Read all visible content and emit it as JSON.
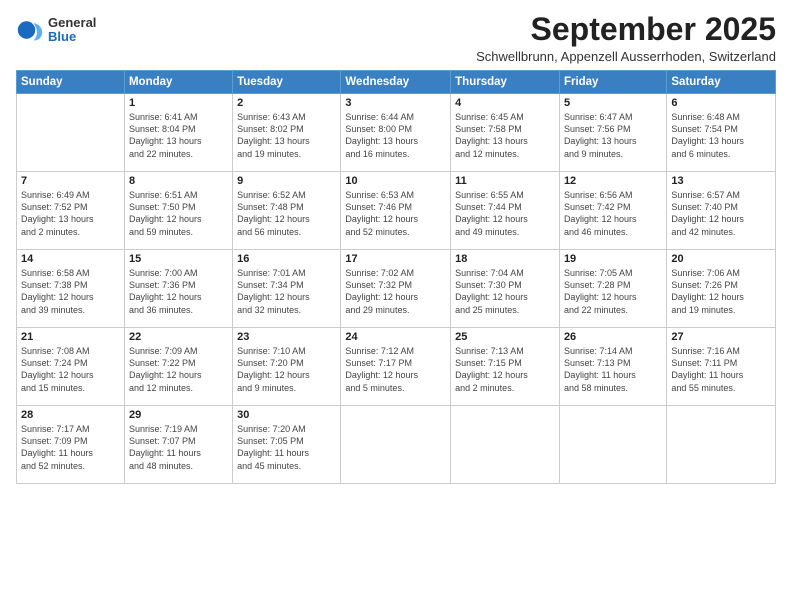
{
  "logo": {
    "general": "General",
    "blue": "Blue"
  },
  "title": "September 2025",
  "subtitle": "Schwellbrunn, Appenzell Ausserrhoden, Switzerland",
  "days_of_week": [
    "Sunday",
    "Monday",
    "Tuesday",
    "Wednesday",
    "Thursday",
    "Friday",
    "Saturday"
  ],
  "weeks": [
    [
      {
        "num": "",
        "info": ""
      },
      {
        "num": "1",
        "info": "Sunrise: 6:41 AM\nSunset: 8:04 PM\nDaylight: 13 hours\nand 22 minutes."
      },
      {
        "num": "2",
        "info": "Sunrise: 6:43 AM\nSunset: 8:02 PM\nDaylight: 13 hours\nand 19 minutes."
      },
      {
        "num": "3",
        "info": "Sunrise: 6:44 AM\nSunset: 8:00 PM\nDaylight: 13 hours\nand 16 minutes."
      },
      {
        "num": "4",
        "info": "Sunrise: 6:45 AM\nSunset: 7:58 PM\nDaylight: 13 hours\nand 12 minutes."
      },
      {
        "num": "5",
        "info": "Sunrise: 6:47 AM\nSunset: 7:56 PM\nDaylight: 13 hours\nand 9 minutes."
      },
      {
        "num": "6",
        "info": "Sunrise: 6:48 AM\nSunset: 7:54 PM\nDaylight: 13 hours\nand 6 minutes."
      }
    ],
    [
      {
        "num": "7",
        "info": "Sunrise: 6:49 AM\nSunset: 7:52 PM\nDaylight: 13 hours\nand 2 minutes."
      },
      {
        "num": "8",
        "info": "Sunrise: 6:51 AM\nSunset: 7:50 PM\nDaylight: 12 hours\nand 59 minutes."
      },
      {
        "num": "9",
        "info": "Sunrise: 6:52 AM\nSunset: 7:48 PM\nDaylight: 12 hours\nand 56 minutes."
      },
      {
        "num": "10",
        "info": "Sunrise: 6:53 AM\nSunset: 7:46 PM\nDaylight: 12 hours\nand 52 minutes."
      },
      {
        "num": "11",
        "info": "Sunrise: 6:55 AM\nSunset: 7:44 PM\nDaylight: 12 hours\nand 49 minutes."
      },
      {
        "num": "12",
        "info": "Sunrise: 6:56 AM\nSunset: 7:42 PM\nDaylight: 12 hours\nand 46 minutes."
      },
      {
        "num": "13",
        "info": "Sunrise: 6:57 AM\nSunset: 7:40 PM\nDaylight: 12 hours\nand 42 minutes."
      }
    ],
    [
      {
        "num": "14",
        "info": "Sunrise: 6:58 AM\nSunset: 7:38 PM\nDaylight: 12 hours\nand 39 minutes."
      },
      {
        "num": "15",
        "info": "Sunrise: 7:00 AM\nSunset: 7:36 PM\nDaylight: 12 hours\nand 36 minutes."
      },
      {
        "num": "16",
        "info": "Sunrise: 7:01 AM\nSunset: 7:34 PM\nDaylight: 12 hours\nand 32 minutes."
      },
      {
        "num": "17",
        "info": "Sunrise: 7:02 AM\nSunset: 7:32 PM\nDaylight: 12 hours\nand 29 minutes."
      },
      {
        "num": "18",
        "info": "Sunrise: 7:04 AM\nSunset: 7:30 PM\nDaylight: 12 hours\nand 25 minutes."
      },
      {
        "num": "19",
        "info": "Sunrise: 7:05 AM\nSunset: 7:28 PM\nDaylight: 12 hours\nand 22 minutes."
      },
      {
        "num": "20",
        "info": "Sunrise: 7:06 AM\nSunset: 7:26 PM\nDaylight: 12 hours\nand 19 minutes."
      }
    ],
    [
      {
        "num": "21",
        "info": "Sunrise: 7:08 AM\nSunset: 7:24 PM\nDaylight: 12 hours\nand 15 minutes."
      },
      {
        "num": "22",
        "info": "Sunrise: 7:09 AM\nSunset: 7:22 PM\nDaylight: 12 hours\nand 12 minutes."
      },
      {
        "num": "23",
        "info": "Sunrise: 7:10 AM\nSunset: 7:20 PM\nDaylight: 12 hours\nand 9 minutes."
      },
      {
        "num": "24",
        "info": "Sunrise: 7:12 AM\nSunset: 7:17 PM\nDaylight: 12 hours\nand 5 minutes."
      },
      {
        "num": "25",
        "info": "Sunrise: 7:13 AM\nSunset: 7:15 PM\nDaylight: 12 hours\nand 2 minutes."
      },
      {
        "num": "26",
        "info": "Sunrise: 7:14 AM\nSunset: 7:13 PM\nDaylight: 11 hours\nand 58 minutes."
      },
      {
        "num": "27",
        "info": "Sunrise: 7:16 AM\nSunset: 7:11 PM\nDaylight: 11 hours\nand 55 minutes."
      }
    ],
    [
      {
        "num": "28",
        "info": "Sunrise: 7:17 AM\nSunset: 7:09 PM\nDaylight: 11 hours\nand 52 minutes."
      },
      {
        "num": "29",
        "info": "Sunrise: 7:19 AM\nSunset: 7:07 PM\nDaylight: 11 hours\nand 48 minutes."
      },
      {
        "num": "30",
        "info": "Sunrise: 7:20 AM\nSunset: 7:05 PM\nDaylight: 11 hours\nand 45 minutes."
      },
      {
        "num": "",
        "info": ""
      },
      {
        "num": "",
        "info": ""
      },
      {
        "num": "",
        "info": ""
      },
      {
        "num": "",
        "info": ""
      }
    ]
  ]
}
